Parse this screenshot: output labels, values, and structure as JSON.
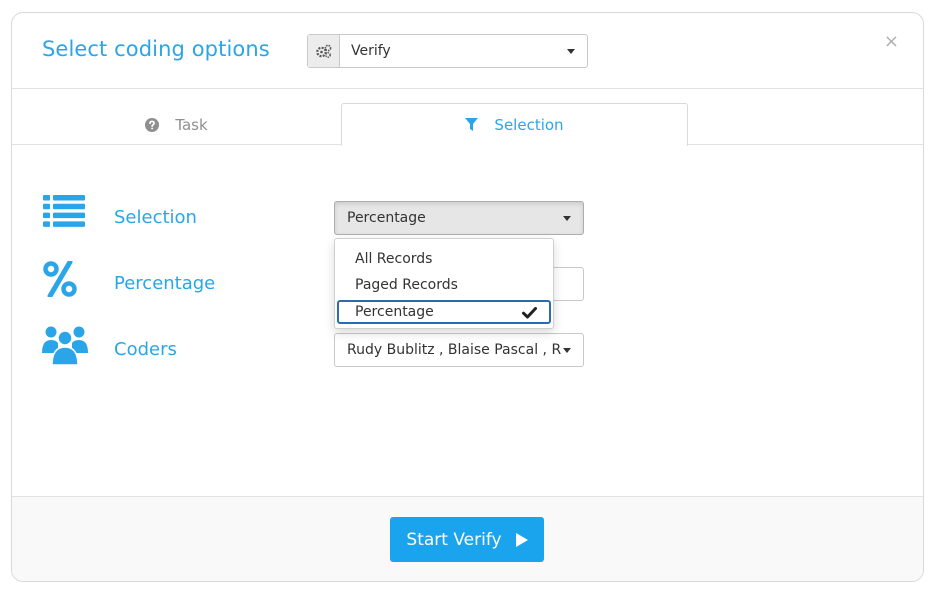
{
  "header": {
    "title": "Select coding options",
    "mode_select": {
      "value": "Verify",
      "icon": "gears-icon"
    },
    "close_label": "×"
  },
  "tabs": [
    {
      "label": "Task",
      "icon": "question-circle-icon",
      "active": false
    },
    {
      "label": "Selection",
      "icon": "filter-icon",
      "active": true
    }
  ],
  "form": {
    "selection": {
      "label": "Selection",
      "icon": "list-icon",
      "value": "Percentage",
      "open": true
    },
    "percentage": {
      "label": "Percentage",
      "icon": "percent-icon",
      "value": ""
    },
    "coders": {
      "label": "Coders",
      "icon": "users-icon",
      "value": "Rudy Bublitz , Blaise Pascal , Robert"
    }
  },
  "dropdown": {
    "options": [
      {
        "label": "All Records",
        "selected": false
      },
      {
        "label": "Paged Records",
        "selected": false
      },
      {
        "label": "Percentage",
        "selected": true
      }
    ]
  },
  "footer": {
    "button_label": "Start Verify"
  },
  "colors": {
    "accent": "#2aa6e8",
    "button": "#1ba4ee"
  }
}
